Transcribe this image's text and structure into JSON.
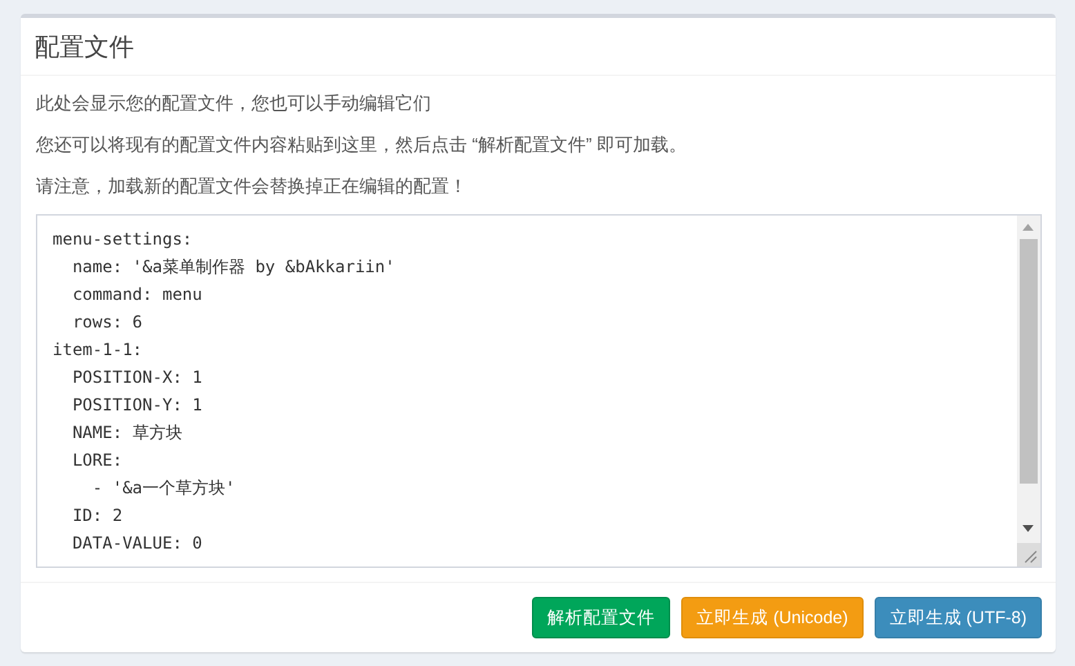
{
  "panel": {
    "title": "配置文件"
  },
  "paragraphs": [
    "此处会显示您的配置文件，您也可以手动编辑它们",
    "您还可以将现有的配置文件内容粘贴到这里，然后点击 “解析配置文件” 即可加载。",
    "请注意，加载新的配置文件会替换掉正在编辑的配置！"
  ],
  "editor": {
    "lines": [
      "menu-settings:",
      "  name: '&a菜单制作器 by &bAkkariin'",
      "  command: menu",
      "  rows: 6",
      "item-1-1:",
      "  POSITION-X: 1",
      "  POSITION-Y: 1",
      "  NAME: 草方块",
      "  LORE:",
      "    - '&a一个草方块'",
      "  ID: 2",
      "  DATA-VALUE: 0"
    ]
  },
  "buttons": [
    {
      "label": "解析配置文件",
      "kind": "success"
    },
    {
      "label": "立即生成 (Unicode)",
      "kind": "warning"
    },
    {
      "label": "立即生成 (UTF-8)",
      "kind": "primary"
    }
  ]
}
